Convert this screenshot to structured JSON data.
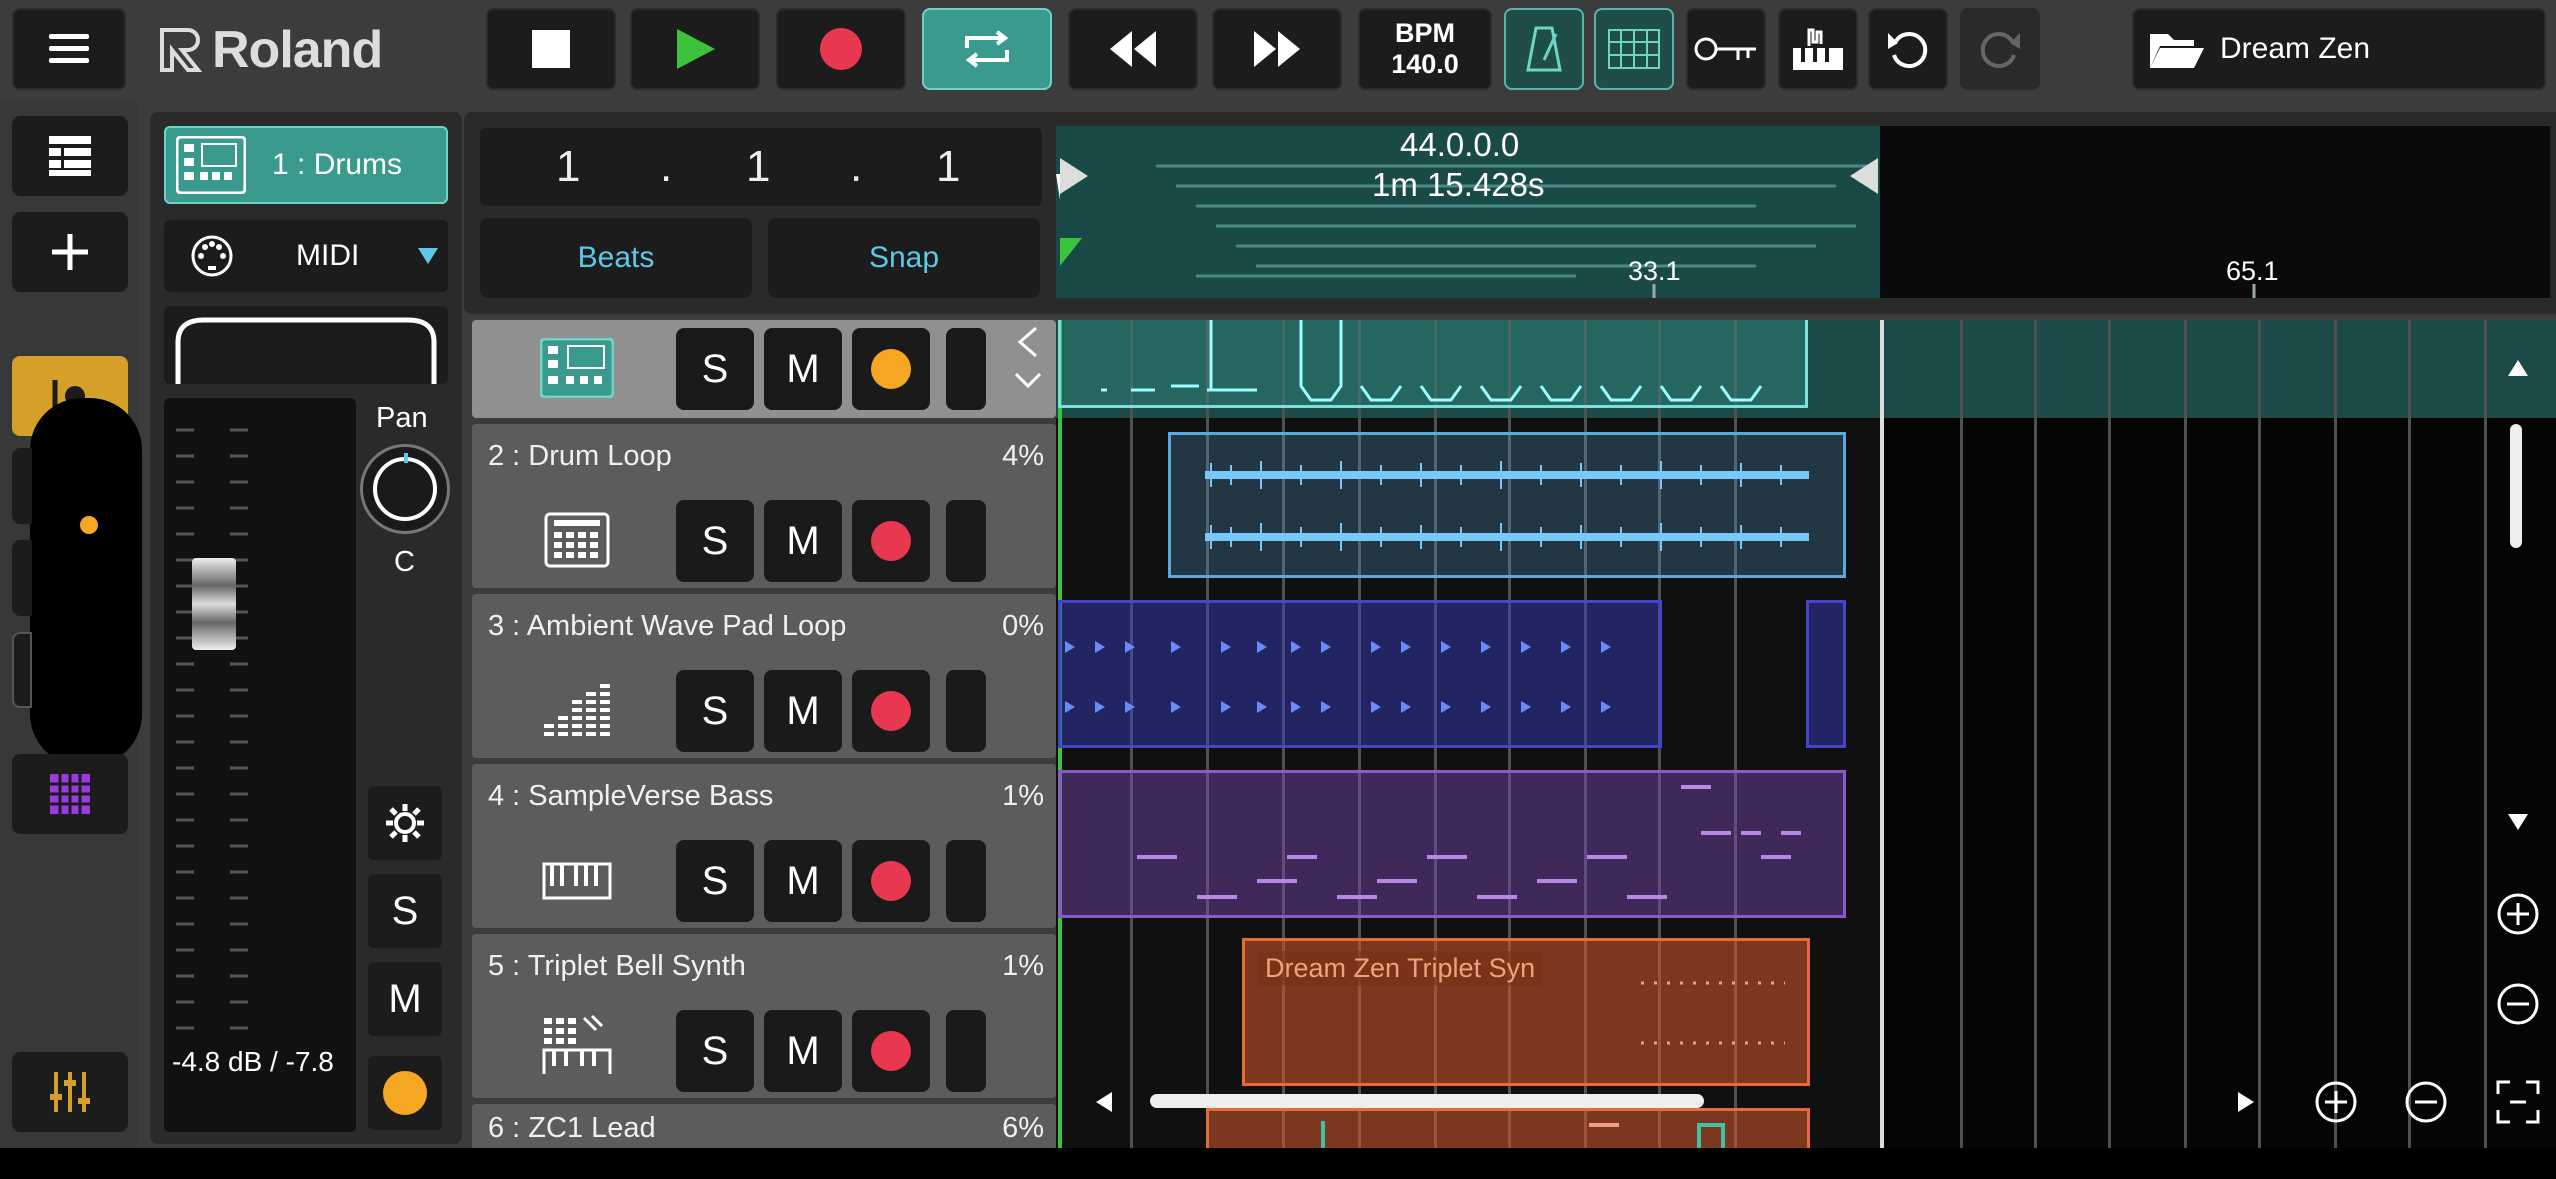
{
  "toolbar": {
    "brand": "Roland",
    "bpm_label": "BPM",
    "bpm_value": "140.0",
    "project_name": "Dream Zen"
  },
  "inspector": {
    "track_label": "1 : Drums",
    "midi_label": "MIDI",
    "pan_label": "Pan",
    "pan_value": "C",
    "level_readout": "-4.8 dB / -7.8",
    "solo": "S",
    "mute": "M"
  },
  "transport": {
    "pos_bar": "1",
    "pos_beat": "1",
    "pos_tick": "1",
    "sep": ".",
    "beats_label": "Beats",
    "snap_label": "Snap"
  },
  "timeline": {
    "position": "44.0.0.0",
    "time": "1m 15.428s",
    "markers": [
      "33.1",
      "65.1"
    ]
  },
  "tracks": [
    {
      "name": "",
      "pct": "",
      "icon": "drum-machine-icon"
    },
    {
      "name": "2 : Drum Loop",
      "pct": "4%",
      "icon": "drum-pad-icon"
    },
    {
      "name": "3 : Ambient Wave Pad Loop",
      "pct": "0%",
      "icon": "level-bars-icon"
    },
    {
      "name": "4 : SampleVerse Bass",
      "pct": "1%",
      "icon": "keyboard-icon"
    },
    {
      "name": "5 : Triplet Bell Synth",
      "pct": "1%",
      "icon": "synth-pad-icon"
    },
    {
      "name": "6 : ZC1 Lead",
      "pct": "6%",
      "icon": "keyboard-icon"
    }
  ],
  "track_buttons": {
    "solo": "S",
    "mute": "M"
  },
  "clips": {
    "triplet_bell_label": "Dream Zen Triplet Syn"
  },
  "colors": {
    "teal": "#3a9a8e",
    "record": "#e8384f",
    "play": "#3ec23e",
    "arm_orange": "#f5a623",
    "drum_loop": "#5aa8e0",
    "pad": "#4446c8",
    "bass": "#7a4ab8",
    "bell": "#d45a2a"
  }
}
